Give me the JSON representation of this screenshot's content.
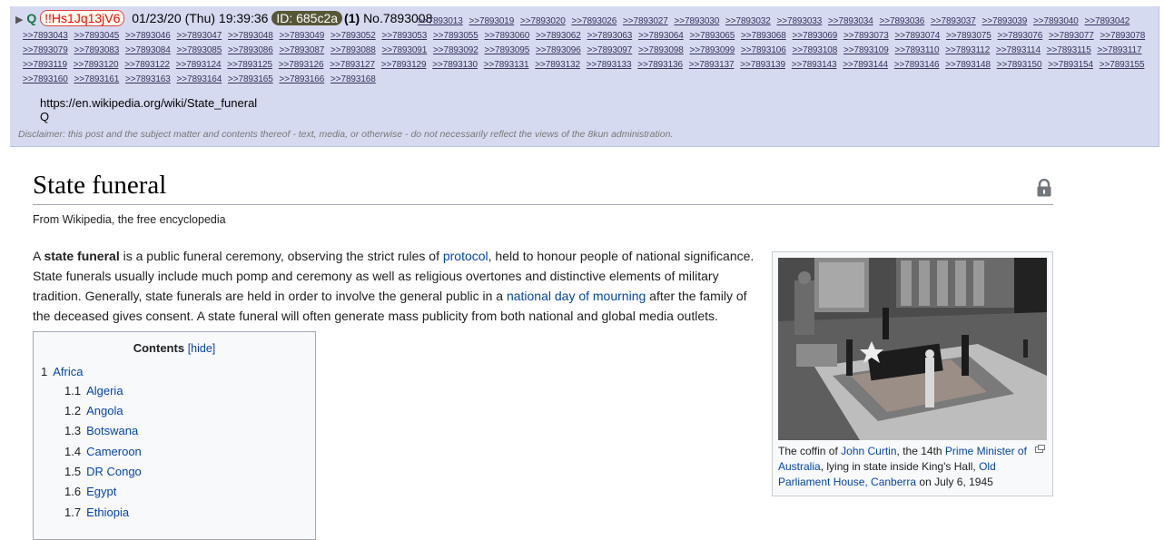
{
  "post": {
    "name": "Q",
    "tripcode": "!!Hs1Jq13jV6",
    "datetime": "01/23/20 (Thu) 19:39:36",
    "id_badge": "ID: 685c2a",
    "id_count": "(1)",
    "post_number": "No.7893008",
    "backlinks": [
      ">>7893013",
      ">>7893019",
      ">>7893020",
      ">>7893026",
      ">>7893027",
      ">>7893030",
      ">>7893032",
      ">>7893033",
      ">>7893034",
      ">>7893036",
      ">>7893037",
      ">>7893039",
      ">>7893040",
      ">>7893042",
      ">>7893043",
      ">>7893045",
      ">>7893046",
      ">>7893047",
      ">>7893048",
      ">>7893049",
      ">>7893052",
      ">>7893053",
      ">>7893055",
      ">>7893060",
      ">>7893062",
      ">>7893063",
      ">>7893064",
      ">>7893065",
      ">>7893068",
      ">>7893069",
      ">>7893073",
      ">>7893074",
      ">>7893075",
      ">>7893076",
      ">>7893077",
      ">>7893078",
      ">>7893079",
      ">>7893083",
      ">>7893084",
      ">>7893085",
      ">>7893086",
      ">>7893087",
      ">>7893088",
      ">>7893091",
      ">>7893092",
      ">>7893095",
      ">>7893096",
      ">>7893097",
      ">>7893098",
      ">>7893099",
      ">>7893106",
      ">>7893108",
      ">>7893109",
      ">>7893110",
      ">>7893112",
      ">>7893114",
      ">>7893115",
      ">>7893117",
      ">>7893119",
      ">>7893120",
      ">>7893122",
      ">>7893124",
      ">>7893125",
      ">>7893126",
      ">>7893127",
      ">>7893129",
      ">>7893130",
      ">>7893131",
      ">>7893132",
      ">>7893133",
      ">>7893136",
      ">>7893137",
      ">>7893139",
      ">>7893143",
      ">>7893144",
      ">>7893146",
      ">>7893148",
      ">>7893150",
      ">>7893154",
      ">>7893155",
      ">>7893160",
      ">>7893161",
      ">>7893163",
      ">>7893164",
      ">>7893165",
      ">>7893166",
      ">>7893168"
    ],
    "body_link": "https://en.wikipedia.org/wiki/State_funeral",
    "signature": "Q",
    "disclaimer": "Disclaimer: this post and the subject matter and contents thereof - text, media, or otherwise - do not necessarily reflect the views of the 8kun administration."
  },
  "article": {
    "title": "State funeral",
    "tagline": "From Wikipedia, the free encyclopedia",
    "lead": {
      "p1": "A ",
      "bold": "state funeral",
      "p2": " is a public funeral ceremony, observing the strict rules of ",
      "link1": "protocol",
      "p3": ", held to honour people of national significance. State funerals usually include much pomp and ceremony as well as religious overtones and distinctive elements of military tradition. Generally, state funerals are held in order to involve the general public in a ",
      "link2": "national day of mourning",
      "p4": " after the family of the deceased gives consent. A state funeral will often generate mass publicity from both national and global media outlets."
    },
    "toc": {
      "title": "Contents",
      "hide": "[hide]",
      "items": [
        {
          "num": "1",
          "label": "Africa"
        },
        {
          "num": "1.1",
          "label": "Algeria"
        },
        {
          "num": "1.2",
          "label": "Angola"
        },
        {
          "num": "1.3",
          "label": "Botswana"
        },
        {
          "num": "1.4",
          "label": "Cameroon"
        },
        {
          "num": "1.5",
          "label": "DR Congo"
        },
        {
          "num": "1.6",
          "label": "Egypt"
        },
        {
          "num": "1.7",
          "label": "Ethiopia"
        }
      ]
    },
    "figure": {
      "c1": "The coffin of ",
      "l1": "John Curtin",
      "c2": ", the 14th ",
      "l2": "Prime Minister of Australia",
      "c3": ", lying in state inside King's Hall, ",
      "l3": "Old Parliament House, Canberra",
      "c4": " on July 6, 1945"
    }
  },
  "colors": {
    "post_bg": "#d6daf0",
    "link": "#0645ad",
    "name_green": "#117743",
    "trip_red": "#ff0000",
    "id_badge_bg": "#575738"
  }
}
